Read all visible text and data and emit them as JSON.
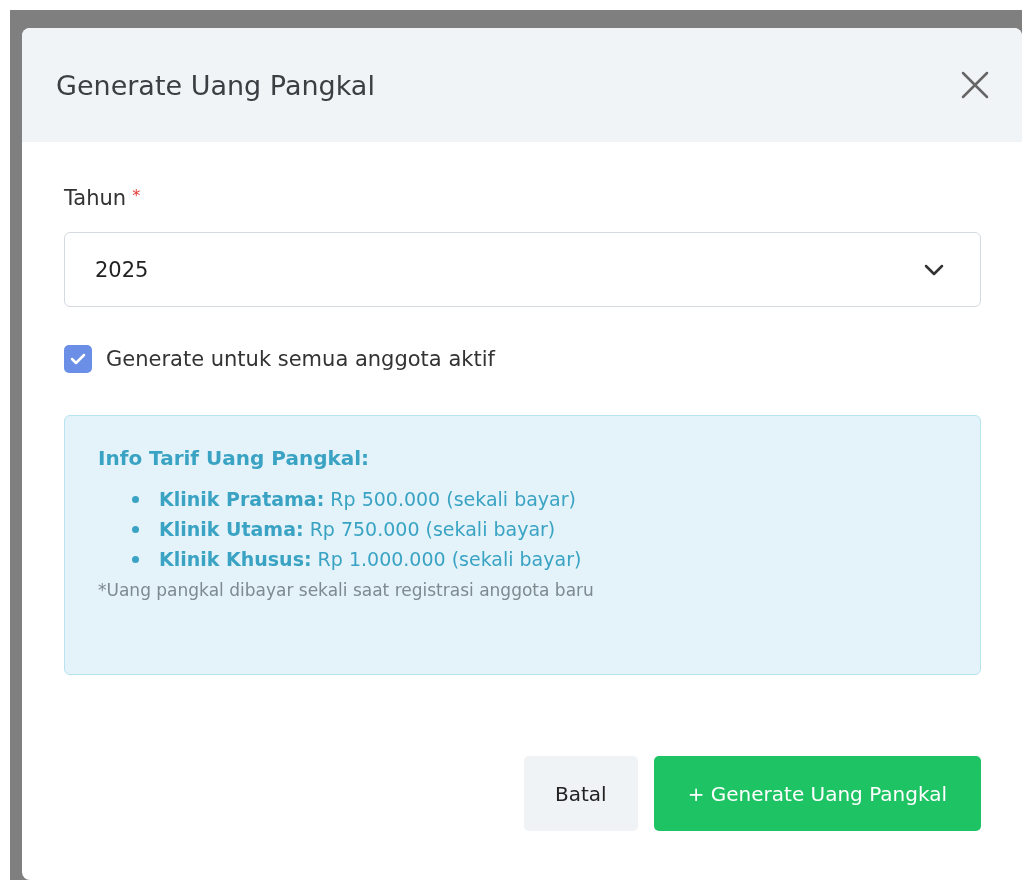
{
  "dialog": {
    "title": "Generate Uang Pangkal"
  },
  "year_field": {
    "label": "Tahun",
    "required_mark": "*",
    "value": "2025"
  },
  "checkbox": {
    "label": "Generate untuk semua anggota aktif",
    "checked": true
  },
  "info": {
    "title": "Info Tarif Uang Pangkal:",
    "items": [
      {
        "label": "Klinik Pratama:",
        "text": "Rp 500.000 (sekali bayar)"
      },
      {
        "label": "Klinik Utama:",
        "text": "Rp 750.000 (sekali bayar)"
      },
      {
        "label": "Klinik Khusus:",
        "text": "Rp 1.000.000 (sekali bayar)"
      }
    ],
    "note": "*Uang pangkal dibayar sekali saat registrasi anggota baru"
  },
  "buttons": [
    {
      "label": "Batal",
      "kind": "secondary"
    },
    {
      "label": "+ Generate Uang Pangkal",
      "kind": "primary"
    }
  ]
}
